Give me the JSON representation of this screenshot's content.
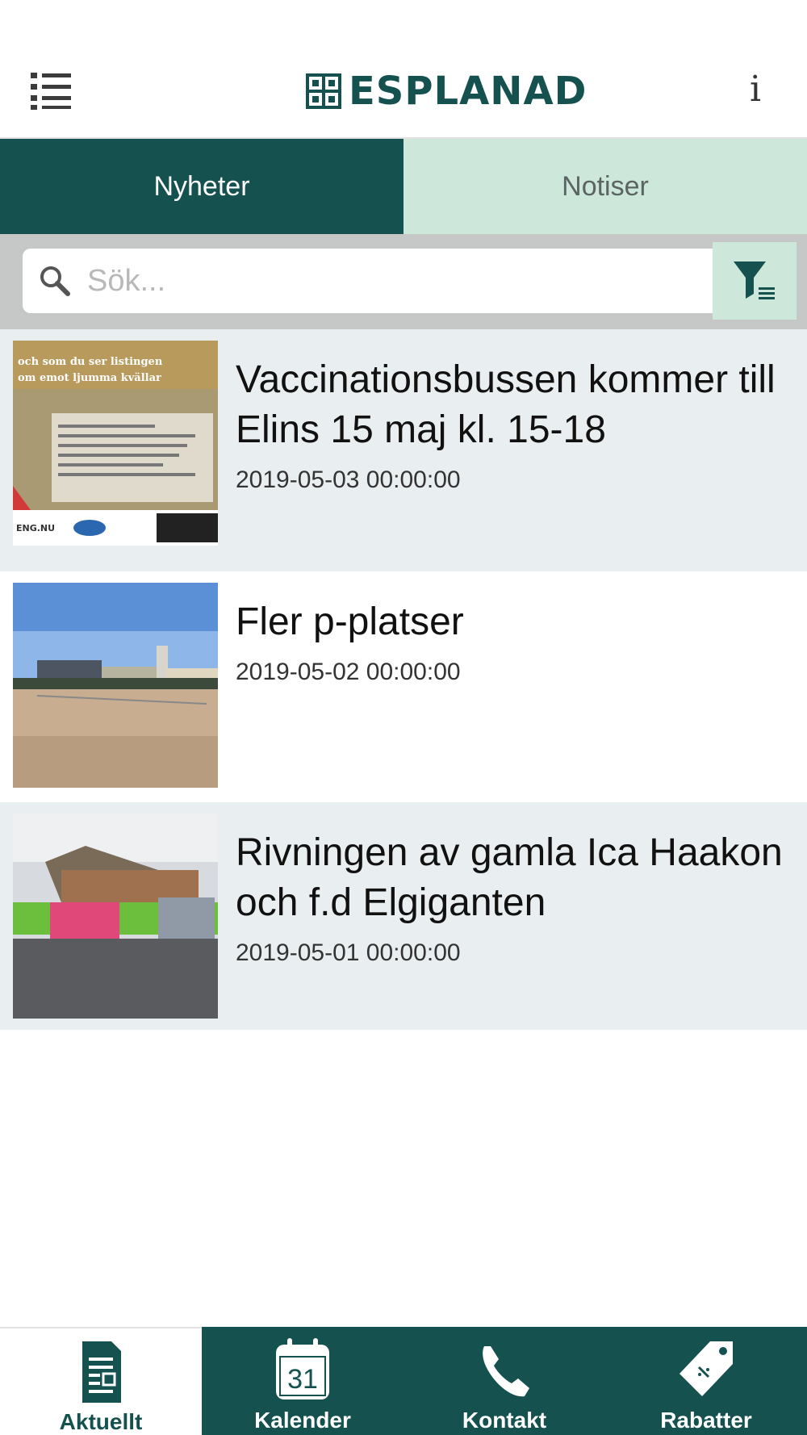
{
  "header": {
    "logo_text": "ESPLANAD",
    "info_label": "i"
  },
  "tabs": [
    {
      "label": "Nyheter",
      "active": true
    },
    {
      "label": "Notiser",
      "active": false
    }
  ],
  "search": {
    "placeholder": "Sök...",
    "value": ""
  },
  "news": [
    {
      "title": "Vaccinationsbussen kommer till Elins 15 maj kl. 15-18",
      "date": "2019-05-03 00:00:00"
    },
    {
      "title": "Fler p-platser",
      "date": "2019-05-02 00:00:00"
    },
    {
      "title": "Rivningen av gamla Ica Haakon och f.d Elgiganten",
      "date": "2019-05-01 00:00:00"
    }
  ],
  "bottom_nav": [
    {
      "label": "Aktuellt",
      "icon": "document-icon",
      "active": true
    },
    {
      "label": "Kalender",
      "icon": "calendar-icon",
      "active": false,
      "calendar_day": "31"
    },
    {
      "label": "Kontakt",
      "icon": "phone-icon",
      "active": false
    },
    {
      "label": "Rabatter",
      "icon": "tag-icon",
      "active": false
    }
  ],
  "colors": {
    "brand": "#14514f",
    "tab_inactive": "#cde7da",
    "row_shade": "#e9eff0"
  }
}
